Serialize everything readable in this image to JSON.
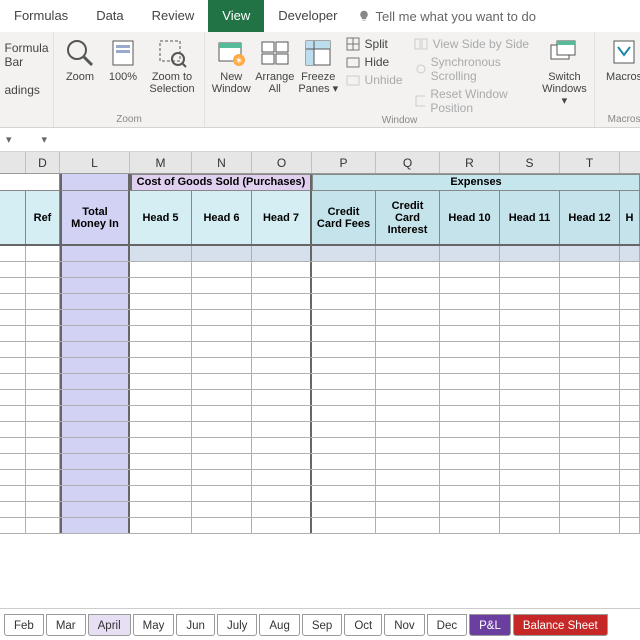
{
  "ribbon": {
    "tabs": [
      "Formulas",
      "Data",
      "Review",
      "View",
      "Developer"
    ],
    "active": "View",
    "tellme": "Tell me what you want to do",
    "show": {
      "formula_bar": "Formula Bar",
      "headings": "adings"
    },
    "zoom": {
      "zoom": "Zoom",
      "hundred": "100%",
      "sel": "Zoom to Selection",
      "group": "Zoom"
    },
    "window": {
      "new": "New Window",
      "arrange": "Arrange All",
      "freeze": "Freeze Panes",
      "split": "Split",
      "hide": "Hide",
      "unhide": "Unhide",
      "sbs": "View Side by Side",
      "sync": "Synchronous Scrolling",
      "reset": "Reset Window Position",
      "switch": "Switch Windows",
      "group": "Window"
    },
    "macros": {
      "macros": "Macros",
      "group": "Macros"
    }
  },
  "cols": [
    "D",
    "L",
    "M",
    "N",
    "O",
    "P",
    "Q",
    "R",
    "S",
    "T"
  ],
  "headers": {
    "blank": "",
    "ref": "Ref",
    "total": "Total Money In",
    "cogs": "Cost of Goods Sold (Purchases)",
    "expenses": "Expenses",
    "h5": "Head 5",
    "h6": "Head 6",
    "h7": "Head 7",
    "ccf": "Credit Card Fees",
    "cci": "Credit Card Interest",
    "h10": "Head 10",
    "h11": "Head 11",
    "h12": "Head 12",
    "h13": "H"
  },
  "sheets": [
    "Feb",
    "Mar",
    "April",
    "May",
    "Jun",
    "July",
    "Aug",
    "Sep",
    "Oct",
    "Nov",
    "Dec",
    "P&L",
    "Balance Sheet"
  ]
}
